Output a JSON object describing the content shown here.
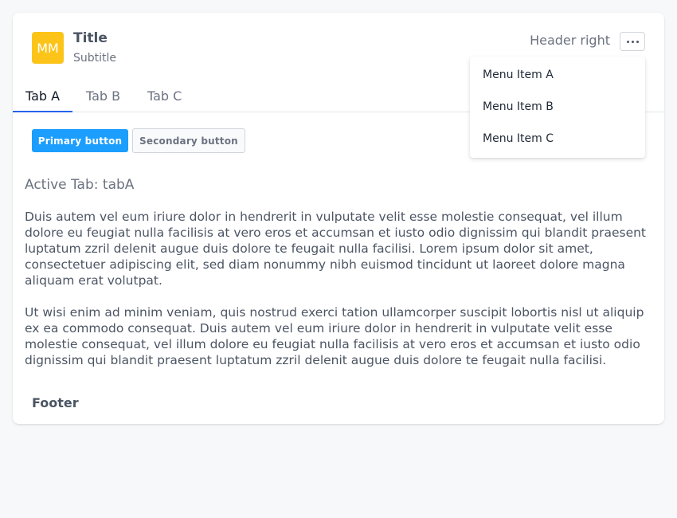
{
  "colors": {
    "avatar_bg": "#fcc419",
    "primary": "#1c9eff",
    "tab_active_border": "#2563eb"
  },
  "header": {
    "avatar_initials": "MM",
    "title": "Title",
    "subtitle": "Subtitle",
    "right_text": "Header right",
    "more_icon": "more-horizontal-icon"
  },
  "tabs": [
    {
      "label": "Tab A",
      "active": true
    },
    {
      "label": "Tab B",
      "active": false
    },
    {
      "label": "Tab C",
      "active": false
    }
  ],
  "actions": {
    "primary_label": "Primary button",
    "secondary_label": "Secondary button"
  },
  "content": {
    "active_tab_text": "Active Tab: tabA",
    "paragraphs": [
      "Duis autem vel eum iriure dolor in hendrerit in vulputate velit esse molestie consequat, vel illum dolore eu feugiat nulla facilisis at vero eros et accumsan et iusto odio dignissim qui blandit praesent luptatum zzril delenit augue duis dolore te feugait nulla facilisi. Lorem ipsum dolor sit amet, consectetuer adipiscing elit, sed diam nonummy nibh euismod tincidunt ut laoreet dolore magna aliquam erat volutpat.",
      "Ut wisi enim ad minim veniam, quis nostrud exerci tation ullamcorper suscipit lobortis nisl ut aliquip ex ea commodo consequat. Duis autem vel eum iriure dolor in hendrerit in vulputate velit esse molestie consequat, vel illum dolore eu feugiat nulla facilisis at vero eros et accumsan et iusto odio dignissim qui blandit praesent luptatum zzril delenit augue duis dolore te feugait nulla facilisi."
    ]
  },
  "footer": {
    "text": "Footer"
  },
  "menu": {
    "items": [
      "Menu Item A",
      "Menu Item B",
      "Menu Item C"
    ]
  }
}
